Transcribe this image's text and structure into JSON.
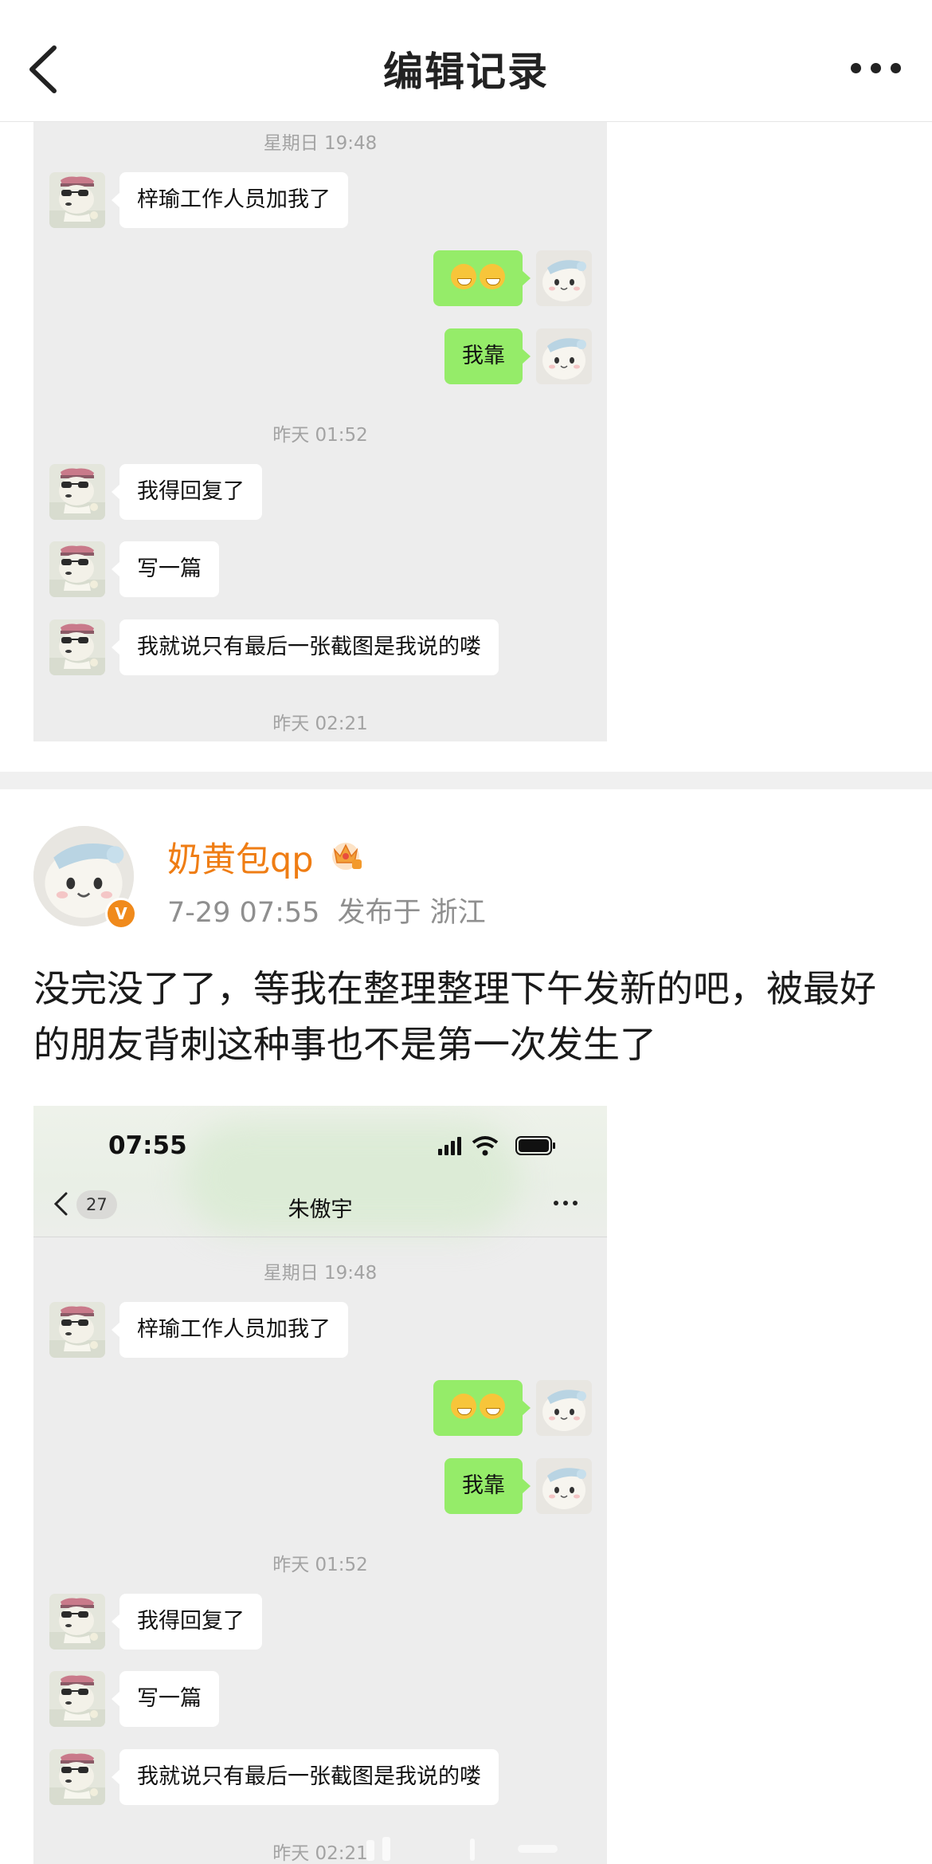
{
  "header": {
    "title": "编辑记录"
  },
  "chat_top": {
    "messages": {
      "time1": "星期日 19:48",
      "msg1": "梓瑜工作人员加我了",
      "msg3": "我靠",
      "time2": "昨天 01:52",
      "msg4": "我得回复了",
      "msg5": "写一篇",
      "msg6": "我就说只有最后一张截图是我说的喽",
      "time3": "昨天 02:21"
    }
  },
  "post": {
    "username": "奶黄包qp",
    "date": "7-29 07:55",
    "location": "发布于 浙江",
    "verified_badge": "V",
    "text": "没完没了了，等我在整理整理下午发新的吧，被最好的朋友背刺这种事也不是第一次发生了"
  },
  "chat_bottom": {
    "status_time": "07:55",
    "nav_count": "27",
    "nav_title": "朱傲宇",
    "messages": {
      "time1": "星期日 19:48",
      "msg1": "梓瑜工作人员加我了",
      "msg3": "我靠",
      "time2": "昨天 01:52",
      "msg4": "我得回复了",
      "msg5": "写一篇",
      "msg6": "我就说只有最后一张截图是我说的喽",
      "time3": "昨天 02:21"
    }
  },
  "colors": {
    "accent_orange": "#ef7d14",
    "wechat_green": "#95ec69",
    "chat_bg": "#ededed"
  },
  "icons": [
    "back-chevron-icon",
    "more-dots-icon",
    "crown-icon",
    "verified-v-icon",
    "signal-icon",
    "wifi-icon",
    "battery-icon"
  ]
}
